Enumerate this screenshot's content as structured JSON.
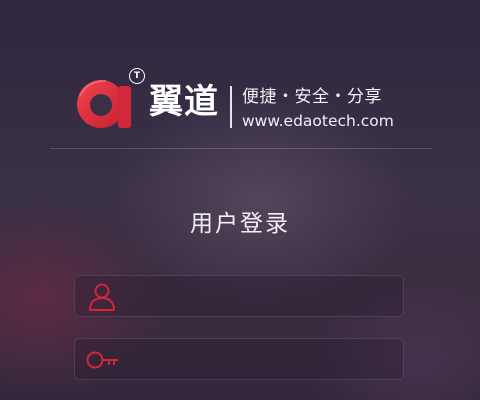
{
  "brand": {
    "trademark": "T",
    "name": "翼道",
    "tagline": "便捷・安全・分享",
    "website": "www.edaotech.com"
  },
  "login": {
    "title": "用户登录",
    "username": {
      "value": "",
      "placeholder": "",
      "icon": "user-icon"
    },
    "password": {
      "value": "",
      "placeholder": "",
      "icon": "key-icon"
    }
  },
  "colors": {
    "accent": "#d8243a",
    "logo_red": "#e03040",
    "text": "#ffffff"
  }
}
